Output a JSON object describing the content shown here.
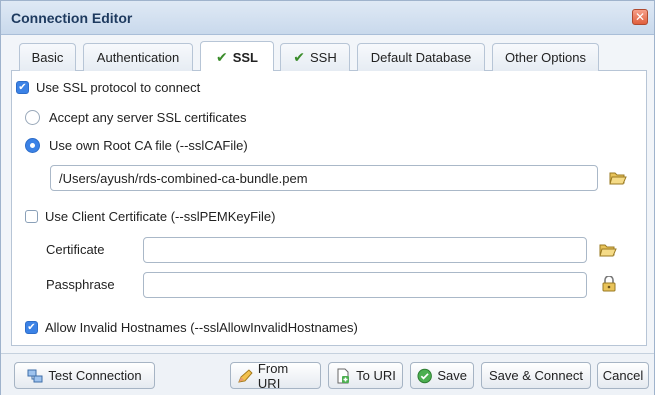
{
  "window": {
    "title": "Connection Editor",
    "close_glyph": "✕"
  },
  "tabs": [
    {
      "label": "Basic",
      "icon": ""
    },
    {
      "label": "Authentication",
      "icon": ""
    },
    {
      "label": "SSL",
      "icon": "check-icon"
    },
    {
      "label": "SSH",
      "icon": "check-icon"
    },
    {
      "label": "Default Database",
      "icon": ""
    },
    {
      "label": "Other Options",
      "icon": ""
    }
  ],
  "active_tab": "SSL",
  "ssl": {
    "use_ssl_label": "Use SSL protocol to connect",
    "use_ssl_checked": true,
    "accept_any_label": "Accept any server SSL certificates",
    "accept_any_selected": false,
    "use_own_ca_label": "Use own Root CA file (--sslCAFile)",
    "use_own_ca_selected": true,
    "ca_file_value": "/Users/ayush/rds-combined-ca-bundle.pem",
    "client_cert_label": "Use Client Certificate (--sslPEMKeyFile)",
    "client_cert_checked": false,
    "certificate_label": "Certificate",
    "certificate_value": "",
    "passphrase_label": "Passphrase",
    "passphrase_value": "",
    "allow_invalid_label": "Allow Invalid Hostnames (--sslAllowInvalidHostnames)",
    "allow_invalid_checked": true
  },
  "buttons": {
    "test_connection": "Test Connection",
    "from_uri": "From URI",
    "to_uri": "To URI",
    "save": "Save",
    "save_connect": "Save & Connect",
    "cancel": "Cancel"
  },
  "colors": {
    "accent": "#3b82e6",
    "check_green": "#3a8c2a"
  }
}
